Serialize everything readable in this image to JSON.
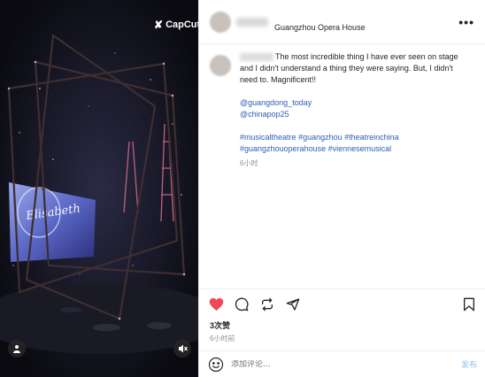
{
  "media": {
    "watermark": "CapCut",
    "icons": [
      "capcut-logo-icon",
      "user-tag-icon",
      "mute-icon"
    ]
  },
  "header": {
    "location": "Guangzhou Opera House",
    "more_icon": "more-horizontal-icon"
  },
  "caption": {
    "text": "The most incredible thing I have ever seen on stage and I didn't understand a thing they were saying. But, I didn't need to. Magnificent!!",
    "mentions": [
      "@guangdong_today",
      "@chinapop25"
    ],
    "hashtags": [
      "#musicaltheatre",
      "#guangzhou",
      "#theatreinchina",
      "#guangzhouoperahouse",
      "#viennesemusical"
    ],
    "time": "6小时"
  },
  "actions": {
    "icons": [
      "heart-filled-icon",
      "comment-icon",
      "repost-icon",
      "share-icon",
      "save-icon"
    ],
    "like_color": "#ed4956"
  },
  "likes": "3次赞",
  "post_time": "6小时前",
  "comment": {
    "placeholder": "添加评论...",
    "publish_label": "发布",
    "emoji_icon": "emoji-icon"
  },
  "colors": {
    "link": "#2f5db7",
    "publish": "#8cc1f2"
  }
}
